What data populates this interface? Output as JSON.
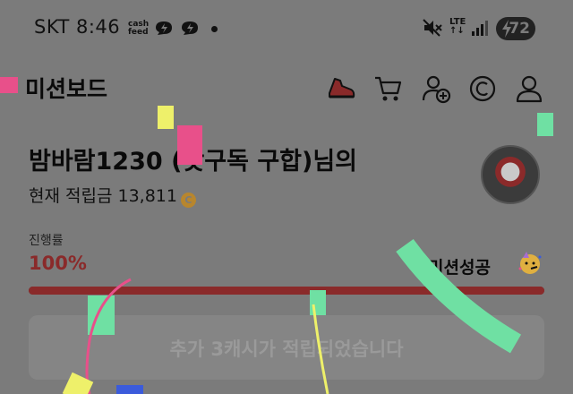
{
  "status_bar": {
    "carrier_time": "SKT 8:46",
    "cashfeed_line1": "cash",
    "cashfeed_line2": "feed",
    "lte_line1": "LTE",
    "lte_line2": "↑↓",
    "battery": "72"
  },
  "header": {
    "title": "미션보드",
    "icons": [
      "shoe-icon",
      "cart-icon",
      "add-friend-icon",
      "copyright-coin-icon",
      "profile-icon"
    ]
  },
  "user": {
    "greeting": "밤바람1230 (맛구독 구합)님의",
    "points_label": "현재 적립금 13,811",
    "coin_symbol": "C"
  },
  "progress": {
    "label": "진행률",
    "value_text": "100%",
    "value": 1.0,
    "success_text": "미션성공"
  },
  "notice": {
    "text": "추가 3캐시가 적립되었습니다"
  },
  "colors": {
    "overlay": "#7b7b7b",
    "accent": "#8a2a2a",
    "confetti_green": "#6fe0a3",
    "confetti_pink": "#e8508a",
    "confetti_yellow": "#eef06a",
    "confetti_blue": "#3b5bdb"
  }
}
